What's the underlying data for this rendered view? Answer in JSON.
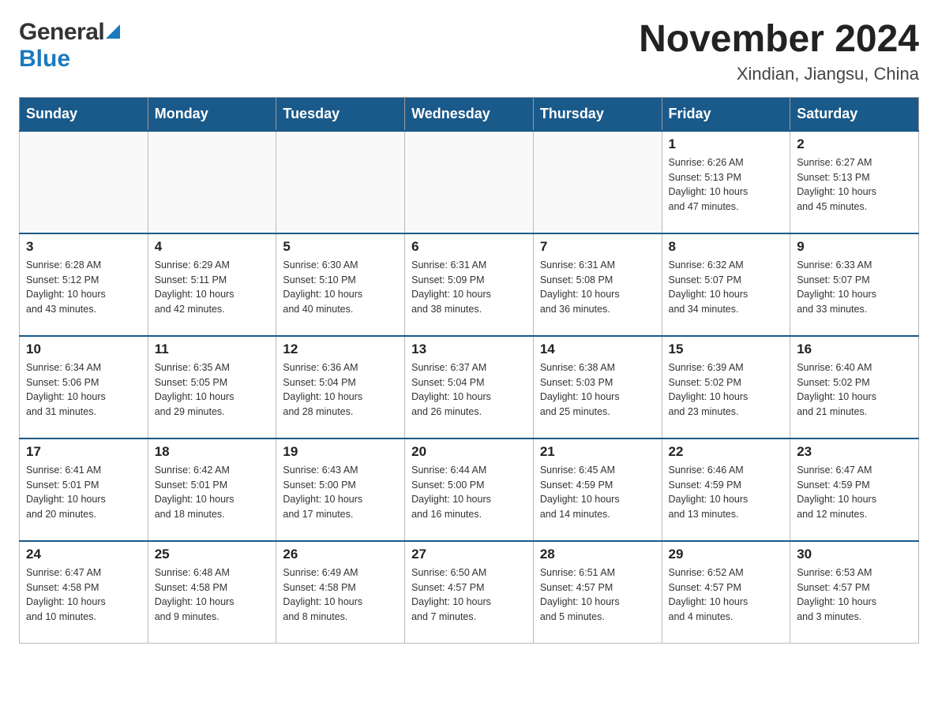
{
  "header": {
    "month_title": "November 2024",
    "location": "Xindian, Jiangsu, China",
    "logo_general": "General",
    "logo_blue": "Blue"
  },
  "weekdays": [
    "Sunday",
    "Monday",
    "Tuesday",
    "Wednesday",
    "Thursday",
    "Friday",
    "Saturday"
  ],
  "weeks": [
    [
      {
        "day": "",
        "info": ""
      },
      {
        "day": "",
        "info": ""
      },
      {
        "day": "",
        "info": ""
      },
      {
        "day": "",
        "info": ""
      },
      {
        "day": "",
        "info": ""
      },
      {
        "day": "1",
        "info": "Sunrise: 6:26 AM\nSunset: 5:13 PM\nDaylight: 10 hours\nand 47 minutes."
      },
      {
        "day": "2",
        "info": "Sunrise: 6:27 AM\nSunset: 5:13 PM\nDaylight: 10 hours\nand 45 minutes."
      }
    ],
    [
      {
        "day": "3",
        "info": "Sunrise: 6:28 AM\nSunset: 5:12 PM\nDaylight: 10 hours\nand 43 minutes."
      },
      {
        "day": "4",
        "info": "Sunrise: 6:29 AM\nSunset: 5:11 PM\nDaylight: 10 hours\nand 42 minutes."
      },
      {
        "day": "5",
        "info": "Sunrise: 6:30 AM\nSunset: 5:10 PM\nDaylight: 10 hours\nand 40 minutes."
      },
      {
        "day": "6",
        "info": "Sunrise: 6:31 AM\nSunset: 5:09 PM\nDaylight: 10 hours\nand 38 minutes."
      },
      {
        "day": "7",
        "info": "Sunrise: 6:31 AM\nSunset: 5:08 PM\nDaylight: 10 hours\nand 36 minutes."
      },
      {
        "day": "8",
        "info": "Sunrise: 6:32 AM\nSunset: 5:07 PM\nDaylight: 10 hours\nand 34 minutes."
      },
      {
        "day": "9",
        "info": "Sunrise: 6:33 AM\nSunset: 5:07 PM\nDaylight: 10 hours\nand 33 minutes."
      }
    ],
    [
      {
        "day": "10",
        "info": "Sunrise: 6:34 AM\nSunset: 5:06 PM\nDaylight: 10 hours\nand 31 minutes."
      },
      {
        "day": "11",
        "info": "Sunrise: 6:35 AM\nSunset: 5:05 PM\nDaylight: 10 hours\nand 29 minutes."
      },
      {
        "day": "12",
        "info": "Sunrise: 6:36 AM\nSunset: 5:04 PM\nDaylight: 10 hours\nand 28 minutes."
      },
      {
        "day": "13",
        "info": "Sunrise: 6:37 AM\nSunset: 5:04 PM\nDaylight: 10 hours\nand 26 minutes."
      },
      {
        "day": "14",
        "info": "Sunrise: 6:38 AM\nSunset: 5:03 PM\nDaylight: 10 hours\nand 25 minutes."
      },
      {
        "day": "15",
        "info": "Sunrise: 6:39 AM\nSunset: 5:02 PM\nDaylight: 10 hours\nand 23 minutes."
      },
      {
        "day": "16",
        "info": "Sunrise: 6:40 AM\nSunset: 5:02 PM\nDaylight: 10 hours\nand 21 minutes."
      }
    ],
    [
      {
        "day": "17",
        "info": "Sunrise: 6:41 AM\nSunset: 5:01 PM\nDaylight: 10 hours\nand 20 minutes."
      },
      {
        "day": "18",
        "info": "Sunrise: 6:42 AM\nSunset: 5:01 PM\nDaylight: 10 hours\nand 18 minutes."
      },
      {
        "day": "19",
        "info": "Sunrise: 6:43 AM\nSunset: 5:00 PM\nDaylight: 10 hours\nand 17 minutes."
      },
      {
        "day": "20",
        "info": "Sunrise: 6:44 AM\nSunset: 5:00 PM\nDaylight: 10 hours\nand 16 minutes."
      },
      {
        "day": "21",
        "info": "Sunrise: 6:45 AM\nSunset: 4:59 PM\nDaylight: 10 hours\nand 14 minutes."
      },
      {
        "day": "22",
        "info": "Sunrise: 6:46 AM\nSunset: 4:59 PM\nDaylight: 10 hours\nand 13 minutes."
      },
      {
        "day": "23",
        "info": "Sunrise: 6:47 AM\nSunset: 4:59 PM\nDaylight: 10 hours\nand 12 minutes."
      }
    ],
    [
      {
        "day": "24",
        "info": "Sunrise: 6:47 AM\nSunset: 4:58 PM\nDaylight: 10 hours\nand 10 minutes."
      },
      {
        "day": "25",
        "info": "Sunrise: 6:48 AM\nSunset: 4:58 PM\nDaylight: 10 hours\nand 9 minutes."
      },
      {
        "day": "26",
        "info": "Sunrise: 6:49 AM\nSunset: 4:58 PM\nDaylight: 10 hours\nand 8 minutes."
      },
      {
        "day": "27",
        "info": "Sunrise: 6:50 AM\nSunset: 4:57 PM\nDaylight: 10 hours\nand 7 minutes."
      },
      {
        "day": "28",
        "info": "Sunrise: 6:51 AM\nSunset: 4:57 PM\nDaylight: 10 hours\nand 5 minutes."
      },
      {
        "day": "29",
        "info": "Sunrise: 6:52 AM\nSunset: 4:57 PM\nDaylight: 10 hours\nand 4 minutes."
      },
      {
        "day": "30",
        "info": "Sunrise: 6:53 AM\nSunset: 4:57 PM\nDaylight: 10 hours\nand 3 minutes."
      }
    ]
  ]
}
